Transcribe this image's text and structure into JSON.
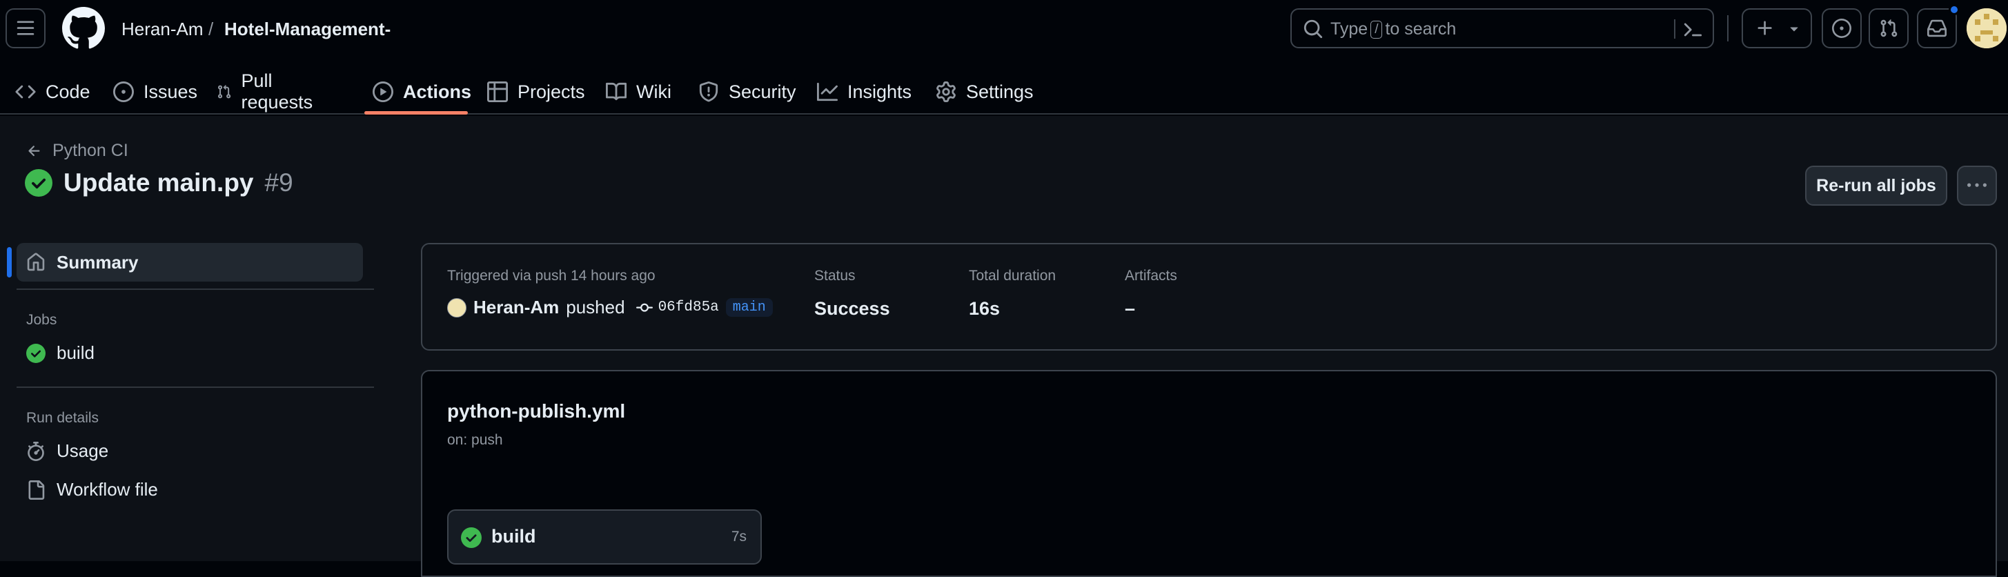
{
  "header": {
    "owner": "Heran-Am",
    "separator": "/",
    "repo": "Hotel-Management-",
    "search_prefix": "Type",
    "search_key": "/",
    "search_suffix": "to search"
  },
  "tabs": [
    {
      "label": "Code",
      "icon": "code-icon"
    },
    {
      "label": "Issues",
      "icon": "issue-opened-icon"
    },
    {
      "label": "Pull requests",
      "icon": "git-pull-request-icon"
    },
    {
      "label": "Actions",
      "icon": "play-icon",
      "active": true
    },
    {
      "label": "Projects",
      "icon": "table-icon"
    },
    {
      "label": "Wiki",
      "icon": "book-icon"
    },
    {
      "label": "Security",
      "icon": "shield-icon"
    },
    {
      "label": "Insights",
      "icon": "graph-icon"
    },
    {
      "label": "Settings",
      "icon": "gear-icon"
    }
  ],
  "run": {
    "workflow_link": "Python CI",
    "title": "Update main.py",
    "number": "#9",
    "rerun_label": "Re-run all jobs"
  },
  "sidebar": {
    "summary_label": "Summary",
    "jobs_heading": "Jobs",
    "jobs": [
      {
        "label": "build",
        "status": "success"
      }
    ],
    "run_details_heading": "Run details",
    "details": [
      {
        "label": "Usage",
        "icon": "stopwatch-icon"
      },
      {
        "label": "Workflow file",
        "icon": "file-icon"
      }
    ]
  },
  "summary": {
    "trigger_label": "Triggered via push 14 hours ago",
    "actor": "Heran-Am",
    "action": "pushed",
    "commit": "06fd85a",
    "branch": "main",
    "status_label": "Status",
    "status_value": "Success",
    "duration_label": "Total duration",
    "duration_value": "16s",
    "artifacts_label": "Artifacts",
    "artifacts_value": "–"
  },
  "workflow": {
    "file": "python-publish.yml",
    "on": "on: push",
    "job_name": "build",
    "job_time": "7s"
  },
  "colors": {
    "accent_tab": "#f78166",
    "success": "#3fb950",
    "link_blue": "#4493f8",
    "selected_bar": "#1f6feb"
  }
}
